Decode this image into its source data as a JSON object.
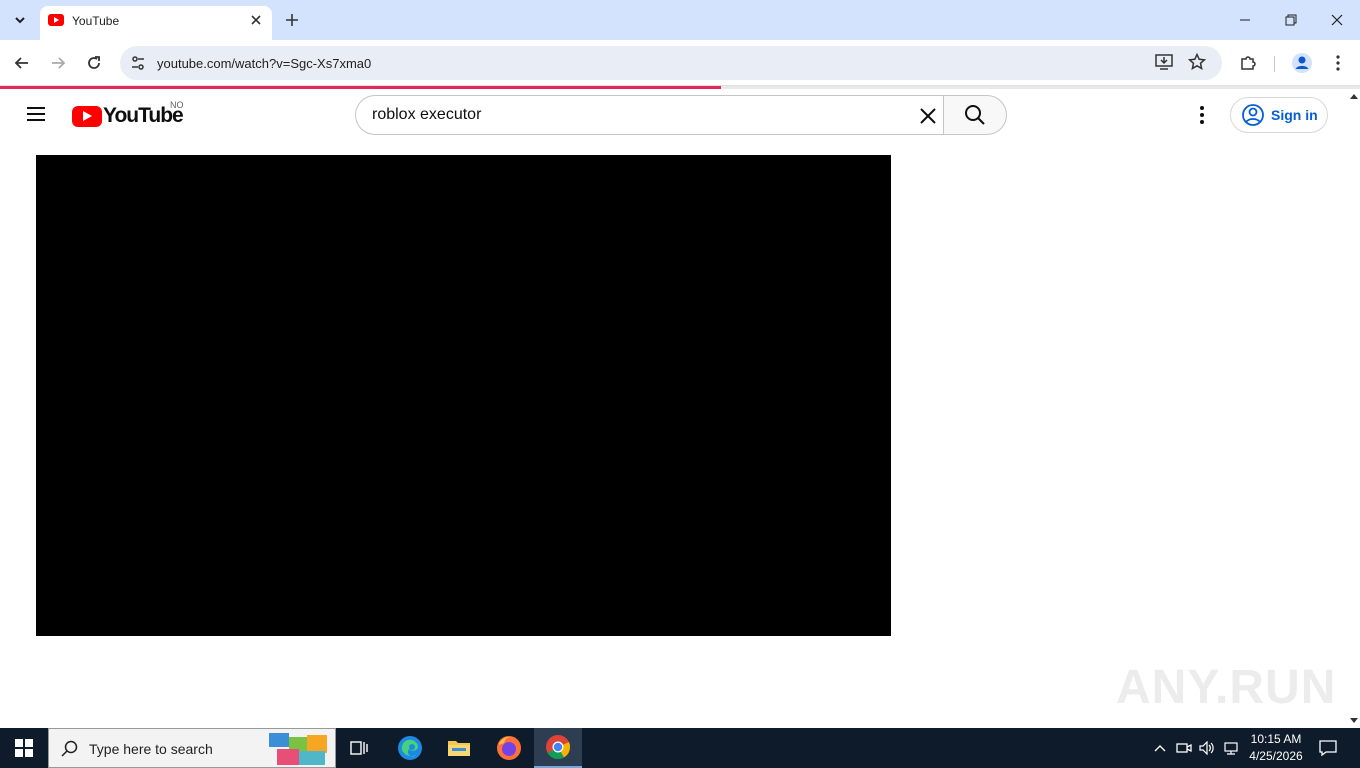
{
  "browser": {
    "tab": {
      "title": "YouTube"
    },
    "url": "youtube.com/watch?v=Sgc-Xs7xma0",
    "load_progress_percent": 53
  },
  "youtube": {
    "logo_text": "YouTube",
    "country_code": "NO",
    "search": {
      "value": "roblox executor"
    },
    "sign_in_label": "Sign in",
    "accent_color": "#ff0000",
    "link_color": "#065fd4"
  },
  "watermark": "ANY.RUN",
  "taskbar": {
    "search_placeholder": "Type here to search",
    "time": "10:15 AM",
    "date": "4/25/2026",
    "apps": [
      "task-view-icon",
      "edge-icon",
      "file-explorer-icon",
      "firefox-icon",
      "chrome-icon"
    ]
  }
}
